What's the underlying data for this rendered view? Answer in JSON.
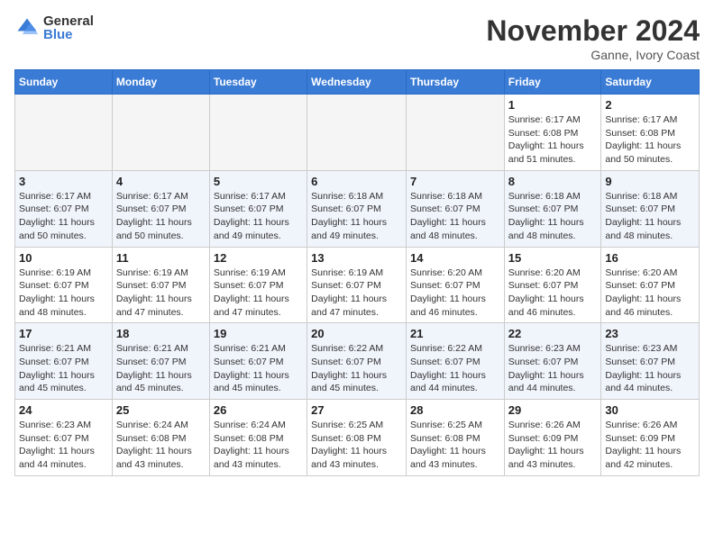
{
  "logo": {
    "general": "General",
    "blue": "Blue"
  },
  "title": "November 2024",
  "location": "Ganne, Ivory Coast",
  "weekdays": [
    "Sunday",
    "Monday",
    "Tuesday",
    "Wednesday",
    "Thursday",
    "Friday",
    "Saturday"
  ],
  "weeks": [
    [
      {
        "day": "",
        "info": ""
      },
      {
        "day": "",
        "info": ""
      },
      {
        "day": "",
        "info": ""
      },
      {
        "day": "",
        "info": ""
      },
      {
        "day": "",
        "info": ""
      },
      {
        "day": "1",
        "info": "Sunrise: 6:17 AM\nSunset: 6:08 PM\nDaylight: 11 hours and 51 minutes."
      },
      {
        "day": "2",
        "info": "Sunrise: 6:17 AM\nSunset: 6:08 PM\nDaylight: 11 hours and 50 minutes."
      }
    ],
    [
      {
        "day": "3",
        "info": "Sunrise: 6:17 AM\nSunset: 6:07 PM\nDaylight: 11 hours and 50 minutes."
      },
      {
        "day": "4",
        "info": "Sunrise: 6:17 AM\nSunset: 6:07 PM\nDaylight: 11 hours and 50 minutes."
      },
      {
        "day": "5",
        "info": "Sunrise: 6:17 AM\nSunset: 6:07 PM\nDaylight: 11 hours and 49 minutes."
      },
      {
        "day": "6",
        "info": "Sunrise: 6:18 AM\nSunset: 6:07 PM\nDaylight: 11 hours and 49 minutes."
      },
      {
        "day": "7",
        "info": "Sunrise: 6:18 AM\nSunset: 6:07 PM\nDaylight: 11 hours and 48 minutes."
      },
      {
        "day": "8",
        "info": "Sunrise: 6:18 AM\nSunset: 6:07 PM\nDaylight: 11 hours and 48 minutes."
      },
      {
        "day": "9",
        "info": "Sunrise: 6:18 AM\nSunset: 6:07 PM\nDaylight: 11 hours and 48 minutes."
      }
    ],
    [
      {
        "day": "10",
        "info": "Sunrise: 6:19 AM\nSunset: 6:07 PM\nDaylight: 11 hours and 48 minutes."
      },
      {
        "day": "11",
        "info": "Sunrise: 6:19 AM\nSunset: 6:07 PM\nDaylight: 11 hours and 47 minutes."
      },
      {
        "day": "12",
        "info": "Sunrise: 6:19 AM\nSunset: 6:07 PM\nDaylight: 11 hours and 47 minutes."
      },
      {
        "day": "13",
        "info": "Sunrise: 6:19 AM\nSunset: 6:07 PM\nDaylight: 11 hours and 47 minutes."
      },
      {
        "day": "14",
        "info": "Sunrise: 6:20 AM\nSunset: 6:07 PM\nDaylight: 11 hours and 46 minutes."
      },
      {
        "day": "15",
        "info": "Sunrise: 6:20 AM\nSunset: 6:07 PM\nDaylight: 11 hours and 46 minutes."
      },
      {
        "day": "16",
        "info": "Sunrise: 6:20 AM\nSunset: 6:07 PM\nDaylight: 11 hours and 46 minutes."
      }
    ],
    [
      {
        "day": "17",
        "info": "Sunrise: 6:21 AM\nSunset: 6:07 PM\nDaylight: 11 hours and 45 minutes."
      },
      {
        "day": "18",
        "info": "Sunrise: 6:21 AM\nSunset: 6:07 PM\nDaylight: 11 hours and 45 minutes."
      },
      {
        "day": "19",
        "info": "Sunrise: 6:21 AM\nSunset: 6:07 PM\nDaylight: 11 hours and 45 minutes."
      },
      {
        "day": "20",
        "info": "Sunrise: 6:22 AM\nSunset: 6:07 PM\nDaylight: 11 hours and 45 minutes."
      },
      {
        "day": "21",
        "info": "Sunrise: 6:22 AM\nSunset: 6:07 PM\nDaylight: 11 hours and 44 minutes."
      },
      {
        "day": "22",
        "info": "Sunrise: 6:23 AM\nSunset: 6:07 PM\nDaylight: 11 hours and 44 minutes."
      },
      {
        "day": "23",
        "info": "Sunrise: 6:23 AM\nSunset: 6:07 PM\nDaylight: 11 hours and 44 minutes."
      }
    ],
    [
      {
        "day": "24",
        "info": "Sunrise: 6:23 AM\nSunset: 6:07 PM\nDaylight: 11 hours and 44 minutes."
      },
      {
        "day": "25",
        "info": "Sunrise: 6:24 AM\nSunset: 6:08 PM\nDaylight: 11 hours and 43 minutes."
      },
      {
        "day": "26",
        "info": "Sunrise: 6:24 AM\nSunset: 6:08 PM\nDaylight: 11 hours and 43 minutes."
      },
      {
        "day": "27",
        "info": "Sunrise: 6:25 AM\nSunset: 6:08 PM\nDaylight: 11 hours and 43 minutes."
      },
      {
        "day": "28",
        "info": "Sunrise: 6:25 AM\nSunset: 6:08 PM\nDaylight: 11 hours and 43 minutes."
      },
      {
        "day": "29",
        "info": "Sunrise: 6:26 AM\nSunset: 6:09 PM\nDaylight: 11 hours and 43 minutes."
      },
      {
        "day": "30",
        "info": "Sunrise: 6:26 AM\nSunset: 6:09 PM\nDaylight: 11 hours and 42 minutes."
      }
    ]
  ]
}
